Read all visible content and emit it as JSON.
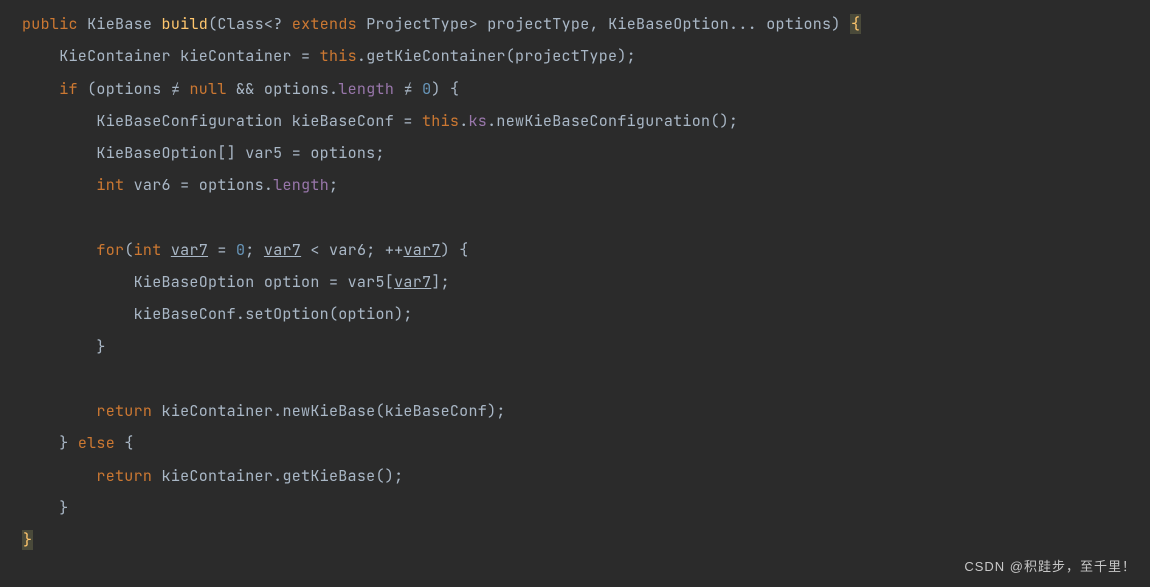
{
  "code": {
    "l1": {
      "kw_public": "public",
      "type_kiebase": "KieBase",
      "fn_build": "build",
      "paren_open": "(",
      "type_class": "Class",
      "angle_open": "<",
      "qmark": "?",
      "kw_extends": "extends",
      "type_projecttype": "ProjectType",
      "angle_close": ">",
      "param_projecttype": "projectType",
      "comma1": ",",
      "type_kiebaseoption": "KieBaseOption",
      "varargs": "...",
      "param_options": "options",
      "paren_close": ")",
      "brace_open": "{"
    },
    "l2": {
      "type_kiecontainer": "KieContainer",
      "var_kiecontainer": "kieContainer",
      "eq": "=",
      "kw_this": "this",
      "dot": ".",
      "fn_getkiecontainer": "getKieContainer",
      "arg_projecttype": "projectType"
    },
    "l3": {
      "kw_if": "if",
      "arg_options1": "options",
      "neq": "≠",
      "kw_null": "null",
      "and": "&&",
      "arg_options2": "options",
      "prop_length": "length",
      "num_zero": "0",
      "brace": "{"
    },
    "l4": {
      "type_kiebaseconf": "KieBaseConfiguration",
      "var_kiebaseconf": "kieBaseConf",
      "eq": "=",
      "kw_this": "this",
      "field_ks": "ks",
      "fn_newkiebaseconf": "newKieBaseConfiguration"
    },
    "l5": {
      "type_kiebaseoption_arr": "KieBaseOption[]",
      "var_var5": "var5",
      "eq": "=",
      "rhs_options": "options"
    },
    "l6": {
      "kw_int": "int",
      "var_var6": "var6",
      "eq": "=",
      "rhs_options": "options",
      "prop_length": "length"
    },
    "l8": {
      "kw_for": "for",
      "kw_int": "int",
      "var_var7a": "var7",
      "eq": "=",
      "num_zero": "0",
      "var_var7b": "var7",
      "lt": "<",
      "var_var6": "var6",
      "inc": "++",
      "var_var7c": "var7",
      "brace": "{"
    },
    "l9": {
      "type_kiebaseoption": "KieBaseOption",
      "var_option": "option",
      "eq": "=",
      "var_var5": "var5",
      "var_var7": "var7"
    },
    "l10": {
      "var_kiebaseconf": "kieBaseConf",
      "fn_setoption": "setOption",
      "arg_option": "option"
    },
    "l11": {
      "brace_close": "}"
    },
    "l13": {
      "kw_return": "return",
      "var_kiecontainer": "kieContainer",
      "fn_newkiebase": "newKieBase",
      "arg_kiebaseconf": "kieBaseConf"
    },
    "l14": {
      "brace_close": "}",
      "kw_else": "else",
      "brace_open": "{"
    },
    "l15": {
      "kw_return": "return",
      "var_kiecontainer": "kieContainer",
      "fn_getkiebase": "getKieBase"
    },
    "l16": {
      "brace_close": "}"
    },
    "l17": {
      "brace_close": "}"
    }
  },
  "watermark": "CSDN @积跬步，至千里！"
}
